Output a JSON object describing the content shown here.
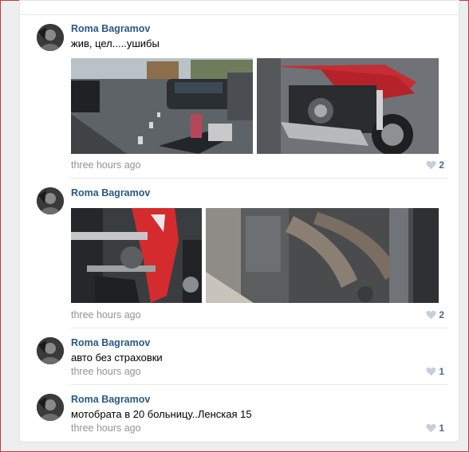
{
  "comments": [
    {
      "author": "Roma Bagramov",
      "text": "жив, цел.....ушибы",
      "time": "three hours ago",
      "likes": "2",
      "photos": [
        {
          "desc": "road-scene"
        },
        {
          "desc": "red-motorcycle-damage"
        }
      ]
    },
    {
      "author": "Roma Bagramov",
      "text": "",
      "time": "three hours ago",
      "likes": "2",
      "photos": [
        {
          "desc": "motorcycle-fairing-closeup"
        },
        {
          "desc": "engine-closeup"
        }
      ]
    },
    {
      "author": "Roma Bagramov",
      "text": "авто без страховки",
      "time": "three hours ago",
      "likes": "1"
    },
    {
      "author": "Roma Bagramov",
      "text": "мотобрата в 20 больницу..Ленская 15",
      "time": "three hours ago",
      "likes": "1"
    }
  ],
  "icons": {
    "like": "heart-icon",
    "avatar": "user-avatar"
  },
  "colors": {
    "author": "#2a5885",
    "meta": "#939393",
    "background": "#edeef0"
  }
}
